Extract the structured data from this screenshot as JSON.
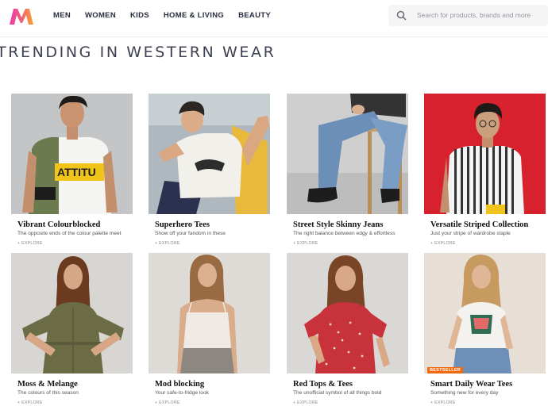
{
  "header": {
    "nav": [
      "MEN",
      "WOMEN",
      "KIDS",
      "HOME & LIVING",
      "BEAUTY"
    ],
    "search_placeholder": "Search for products, brands and more"
  },
  "section": {
    "title": "TRENDING IN WESTERN WEAR"
  },
  "cards": [
    {
      "title": "Vibrant Colourblocked",
      "subtitle": "The opposite ends of the colour palette meet",
      "cta": "+ EXPLORE"
    },
    {
      "title": "Superhero Tees",
      "subtitle": "Show off your fandom in these",
      "cta": "+ EXPLORE"
    },
    {
      "title": "Street Style Skinny Jeans",
      "subtitle": "The right balance between edgy & effortless",
      "cta": "+ EXPLORE"
    },
    {
      "title": "Versatile Striped Collection",
      "subtitle": "Just your stripe of wardrobe staple",
      "cta": "+ EXPLORE"
    },
    {
      "title": "Moss & Melange",
      "subtitle": "The colours of this season",
      "cta": "+ EXPLORE"
    },
    {
      "title": "Mod blocking",
      "subtitle": "Your safe-to-fridge look",
      "cta": "+ EXPLORE"
    },
    {
      "title": "Red Tops & Tees",
      "subtitle": "The unofficial symbol of all things bold",
      "cta": "+ EXPLORE"
    },
    {
      "title": "Smart Daily Wear Tees",
      "subtitle": "Something new for every day",
      "cta": "+ EXPLORE",
      "badge": "BESTSELLER"
    }
  ],
  "colors": {
    "brand_pink": "#ff3f6c",
    "brand_orange": "#f26a10",
    "text_dark": "#282c3f"
  }
}
